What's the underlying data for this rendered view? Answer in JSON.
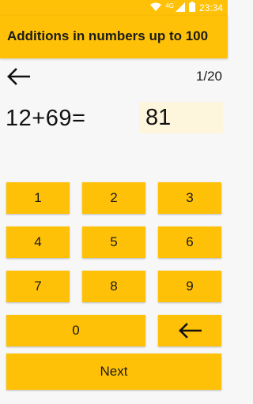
{
  "status_bar": {
    "network_label": "4G",
    "time": "23:34",
    "icons": [
      "wifi-icon",
      "signal-icon",
      "battery-icon"
    ]
  },
  "app_bar": {
    "title": "Additions in numbers up to 100"
  },
  "toolbar": {
    "back_icon": "back-arrow-icon",
    "progress": "1/20"
  },
  "question": {
    "text": "12+69=",
    "answer": "81"
  },
  "keypad": {
    "keys": [
      "1",
      "2",
      "3",
      "4",
      "5",
      "6",
      "7",
      "8",
      "9",
      "0"
    ],
    "backspace_icon": "backspace-arrow-icon",
    "next_label": "Next"
  },
  "colors": {
    "accent": "#ffc107",
    "answer_bg": "#fdf5dc",
    "background": "#f7f7f7"
  }
}
